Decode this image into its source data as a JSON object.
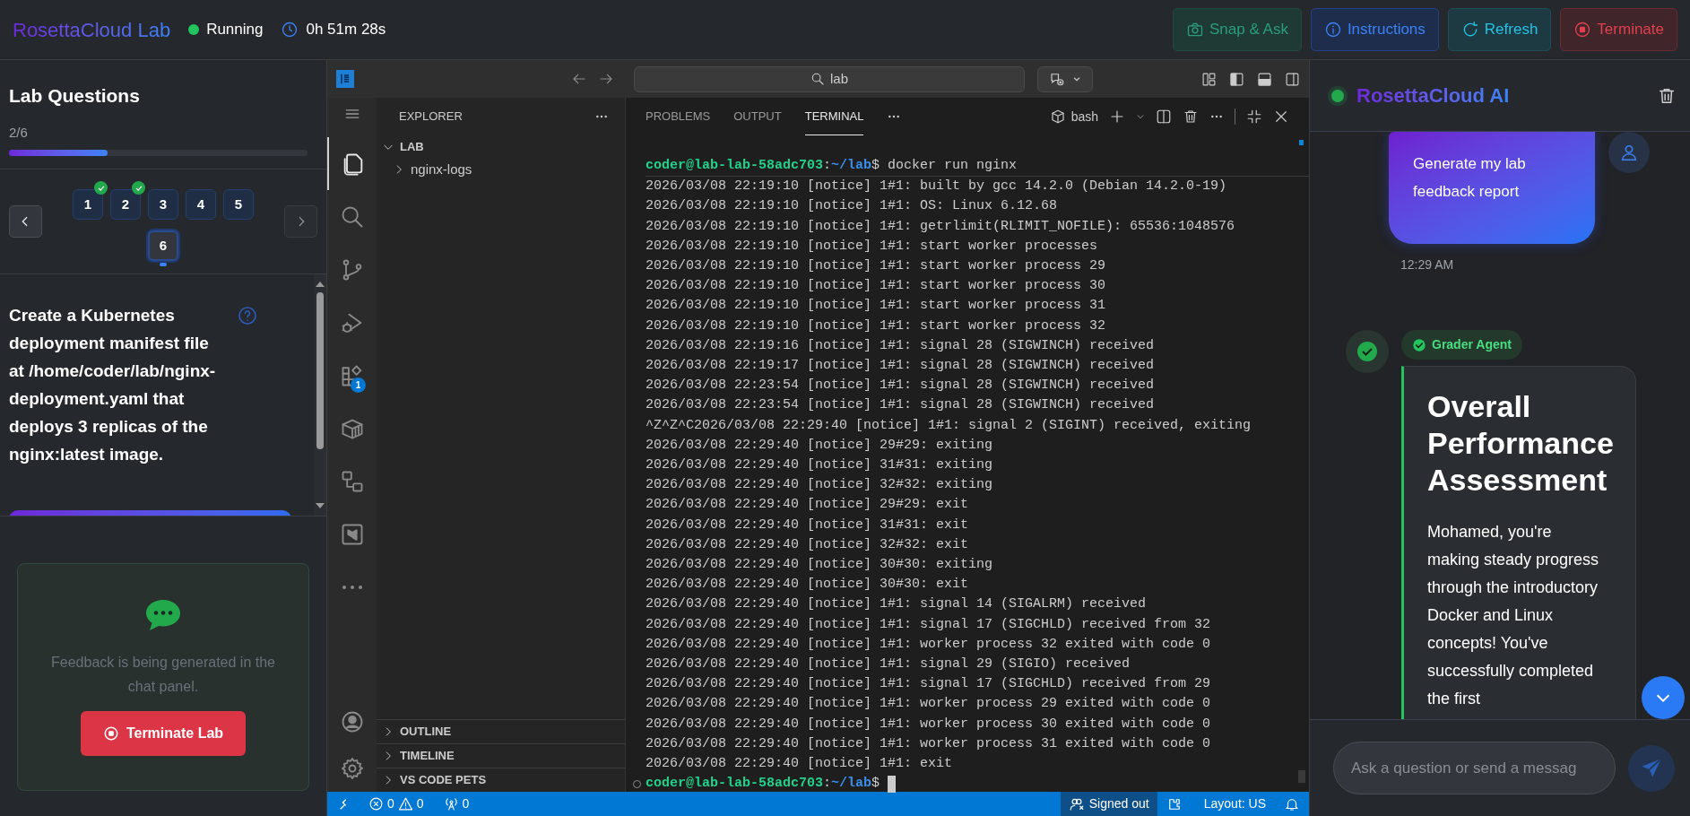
{
  "top_bar": {
    "title": "RosettaCloud Lab",
    "status": "Running",
    "timer": "0h 51m 28s",
    "buttons": [
      {
        "kind": "snap",
        "label": "Snap & Ask"
      },
      {
        "kind": "instructions",
        "label": "Instructions"
      },
      {
        "kind": "refresh",
        "label": "Refresh"
      },
      {
        "kind": "terminate",
        "label": "Terminate"
      }
    ]
  },
  "questions_panel": {
    "title": "Lab Questions",
    "progress_text": "2/6",
    "level": 0.33,
    "items": [
      {
        "label": "1",
        "completed": true,
        "selected": false
      },
      {
        "label": "2",
        "completed": true,
        "selected": false
      },
      {
        "label": "3",
        "completed": false,
        "selected": false
      },
      {
        "label": "4",
        "completed": false,
        "selected": false
      },
      {
        "label": "5",
        "completed": false,
        "selected": false
      },
      {
        "label": "6",
        "completed": false,
        "selected": true
      }
    ],
    "question": "Create a Kubernetes deployment manifest file at /home/coder/lab/nginx-deployment.yaml that deploys 3 replicas of the nginx:latest image.",
    "feedback": {
      "message": "Feedback is being generated in the chat panel.",
      "button": "Terminate Lab"
    }
  },
  "editor": {
    "search": "lab",
    "activity_bar": [
      {
        "kind": "files",
        "selected": true
      },
      {
        "kind": "search",
        "selected": false
      },
      {
        "kind": "git",
        "selected": false
      },
      {
        "kind": "debug",
        "selected": false
      },
      {
        "kind": "extensions",
        "selected": false,
        "badge": "1"
      },
      {
        "kind": "container",
        "selected": false
      },
      {
        "kind": "remote",
        "selected": false
      },
      {
        "kind": "terraform",
        "selected": false
      },
      {
        "kind": "more",
        "selected": false
      }
    ],
    "explorer": {
      "title": "EXPLORER",
      "folder": "LAB",
      "items": [
        {
          "label": "nginx-logs"
        }
      ],
      "sections": [
        "OUTLINE",
        "TIMELINE",
        "VS CODE PETS"
      ]
    },
    "panel_tabs": [
      {
        "label": "PROBLEMS",
        "selected": false
      },
      {
        "label": "OUTPUT",
        "selected": false
      },
      {
        "label": "TERMINAL",
        "selected": true
      }
    ],
    "shell": "bash",
    "terminal": [
      {
        "kind": "prompt",
        "user": "coder@lab-lab-58adc703",
        "separator": ":",
        "path": "~/lab",
        "symbol": "$",
        "command": "docker run nginx"
      },
      {
        "kind": "output",
        "text": "2026/03/08 22:19:10 [notice] 1#1: built by gcc 14.2.0 (Debian 14.2.0-19)"
      },
      {
        "kind": "output",
        "text": "2026/03/08 22:19:10 [notice] 1#1: OS: Linux 6.12.68"
      },
      {
        "kind": "output",
        "text": "2026/03/08 22:19:10 [notice] 1#1: getrlimit(RLIMIT_NOFILE): 65536:1048576"
      },
      {
        "kind": "output",
        "text": "2026/03/08 22:19:10 [notice] 1#1: start worker processes"
      },
      {
        "kind": "output",
        "text": "2026/03/08 22:19:10 [notice] 1#1: start worker process 29"
      },
      {
        "kind": "output",
        "text": "2026/03/08 22:19:10 [notice] 1#1: start worker process 30"
      },
      {
        "kind": "output",
        "text": "2026/03/08 22:19:10 [notice] 1#1: start worker process 31"
      },
      {
        "kind": "output",
        "text": "2026/03/08 22:19:10 [notice] 1#1: start worker process 32"
      },
      {
        "kind": "output",
        "text": "2026/03/08 22:19:16 [notice] 1#1: signal 28 (SIGWINCH) received"
      },
      {
        "kind": "output",
        "text": "2026/03/08 22:19:17 [notice] 1#1: signal 28 (SIGWINCH) received"
      },
      {
        "kind": "output",
        "text": "2026/03/08 22:23:54 [notice] 1#1: signal 28 (SIGWINCH) received"
      },
      {
        "kind": "output",
        "text": "2026/03/08 22:23:54 [notice] 1#1: signal 28 (SIGWINCH) received"
      },
      {
        "kind": "output",
        "text": "^Z^Z^C2026/03/08 22:29:40 [notice] 1#1: signal 2 (SIGINT) received, exiting"
      },
      {
        "kind": "output",
        "text": "2026/03/08 22:29:40 [notice] 29#29: exiting"
      },
      {
        "kind": "output",
        "text": "2026/03/08 22:29:40 [notice] 31#31: exiting"
      },
      {
        "kind": "output",
        "text": "2026/03/08 22:29:40 [notice] 32#32: exiting"
      },
      {
        "kind": "output",
        "text": "2026/03/08 22:29:40 [notice] 29#29: exit"
      },
      {
        "kind": "output",
        "text": "2026/03/08 22:29:40 [notice] 31#31: exit"
      },
      {
        "kind": "output",
        "text": "2026/03/08 22:29:40 [notice] 32#32: exit"
      },
      {
        "kind": "output",
        "text": "2026/03/08 22:29:40 [notice] 30#30: exiting"
      },
      {
        "kind": "output",
        "text": "2026/03/08 22:29:40 [notice] 30#30: exit"
      },
      {
        "kind": "output",
        "text": "2026/03/08 22:29:40 [notice] 1#1: signal 14 (SIGALRM) received"
      },
      {
        "kind": "output",
        "text": "2026/03/08 22:29:40 [notice] 1#1: signal 17 (SIGCHLD) received from 32"
      },
      {
        "kind": "output",
        "text": "2026/03/08 22:29:40 [notice] 1#1: worker process 32 exited with code 0"
      },
      {
        "kind": "output",
        "text": "2026/03/08 22:29:40 [notice] 1#1: signal 29 (SIGIO) received"
      },
      {
        "kind": "output",
        "text": "2026/03/08 22:29:40 [notice] 1#1: signal 17 (SIGCHLD) received from 29"
      },
      {
        "kind": "output",
        "text": "2026/03/08 22:29:40 [notice] 1#1: worker process 29 exited with code 0"
      },
      {
        "kind": "output",
        "text": "2026/03/08 22:29:40 [notice] 1#1: worker process 30 exited with code 0"
      },
      {
        "kind": "output",
        "text": "2026/03/08 22:29:40 [notice] 1#1: worker process 31 exited with code 0"
      },
      {
        "kind": "output",
        "text": "2026/03/08 22:29:40 [notice] 1#1: exit"
      },
      {
        "kind": "prompt",
        "user": "coder@lab-lab-58adc703",
        "separator": ":",
        "path": "~/lab",
        "symbol": "$"
      }
    ],
    "status_bar": {
      "errors": "0",
      "warnings": "0",
      "ports": "0",
      "account": "Signed out",
      "layout": "Layout: US"
    }
  },
  "chat": {
    "title": "RosettaCloud AI",
    "online": true,
    "messages": [
      {
        "kind": "user",
        "text": "Generate my lab feedback report",
        "time": "12:29 AM"
      },
      {
        "kind": "agent",
        "agent": "Grader Agent",
        "heading": "Overall Performance Assessment",
        "text": "Mohamed, you're making steady progress through the introductory Docker and Linux concepts! You've successfully completed the first"
      }
    ],
    "input_placeholder": "Ask a question or send a messag"
  }
}
